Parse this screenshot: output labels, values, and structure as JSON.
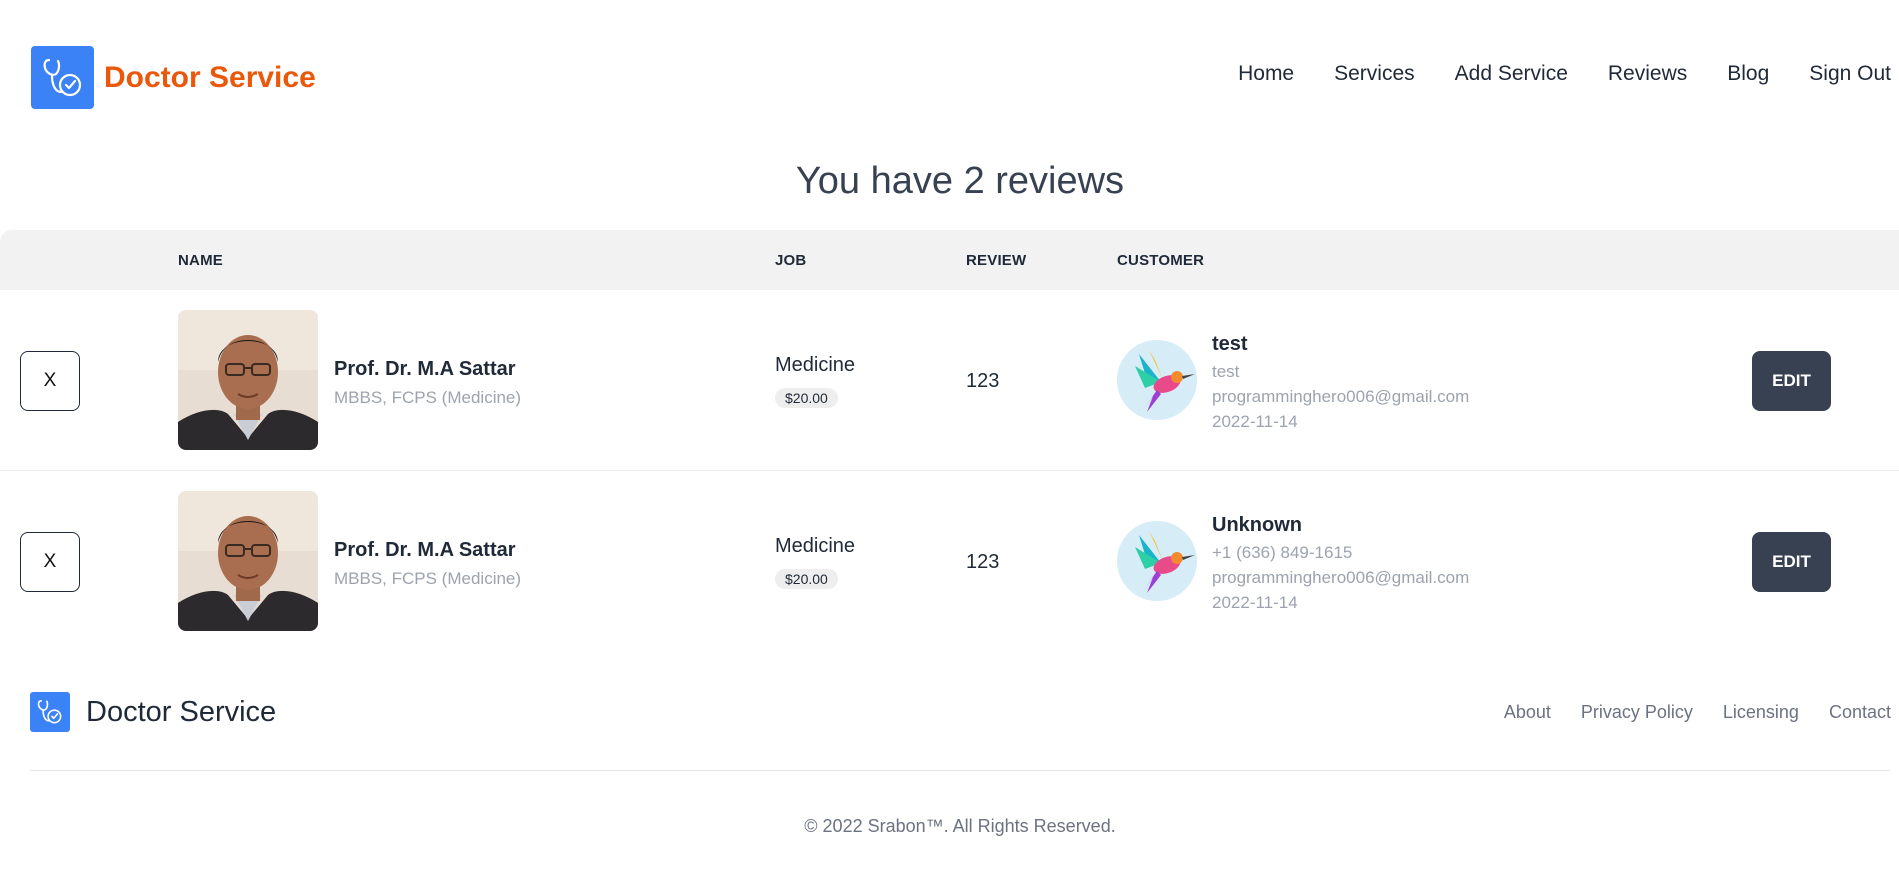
{
  "header": {
    "brand_name": "Doctor Service",
    "brand_color": "#ea580c",
    "logo_icon": "stethoscope-clock-icon",
    "nav": [
      {
        "label": "Home"
      },
      {
        "label": "Services"
      },
      {
        "label": "Add Service"
      },
      {
        "label": "Reviews"
      },
      {
        "label": "Blog"
      },
      {
        "label": "Sign Out"
      }
    ]
  },
  "main": {
    "title": "You have 2 reviews",
    "columns": {
      "name": "NAME",
      "job": "JOB",
      "review": "REVIEW",
      "customer": "CUSTOMER"
    },
    "rows": [
      {
        "delete_label": "X",
        "doctor_name": "Prof. Dr. M.A Sattar",
        "doctor_degree": "MBBS, FCPS (Medicine)",
        "job": "Medicine",
        "price": "$20.00",
        "review": "123",
        "customer_name": "test",
        "customer_detail": "test",
        "customer_email": "programminghero006@gmail.com",
        "customer_date": "2022-11-14",
        "edit_label": "EDIT"
      },
      {
        "delete_label": "X",
        "doctor_name": "Prof. Dr. M.A Sattar",
        "doctor_degree": "MBBS, FCPS (Medicine)",
        "job": "Medicine",
        "price": "$20.00",
        "review": "123",
        "customer_name": "Unknown",
        "customer_detail": "+1 (636) 849-1615",
        "customer_email": "programminghero006@gmail.com",
        "customer_date": "2022-11-14",
        "edit_label": "EDIT"
      }
    ]
  },
  "footer": {
    "brand_name": "Doctor Service",
    "links": [
      {
        "label": "About"
      },
      {
        "label": "Privacy Policy"
      },
      {
        "label": "Licensing"
      },
      {
        "label": "Contact"
      }
    ],
    "copyright": "© 2022 Srabon™. All Rights Reserved."
  },
  "colors": {
    "accent": "#3b82f6",
    "edit_button": "#374151",
    "table_header_bg": "#f2f2f2"
  }
}
